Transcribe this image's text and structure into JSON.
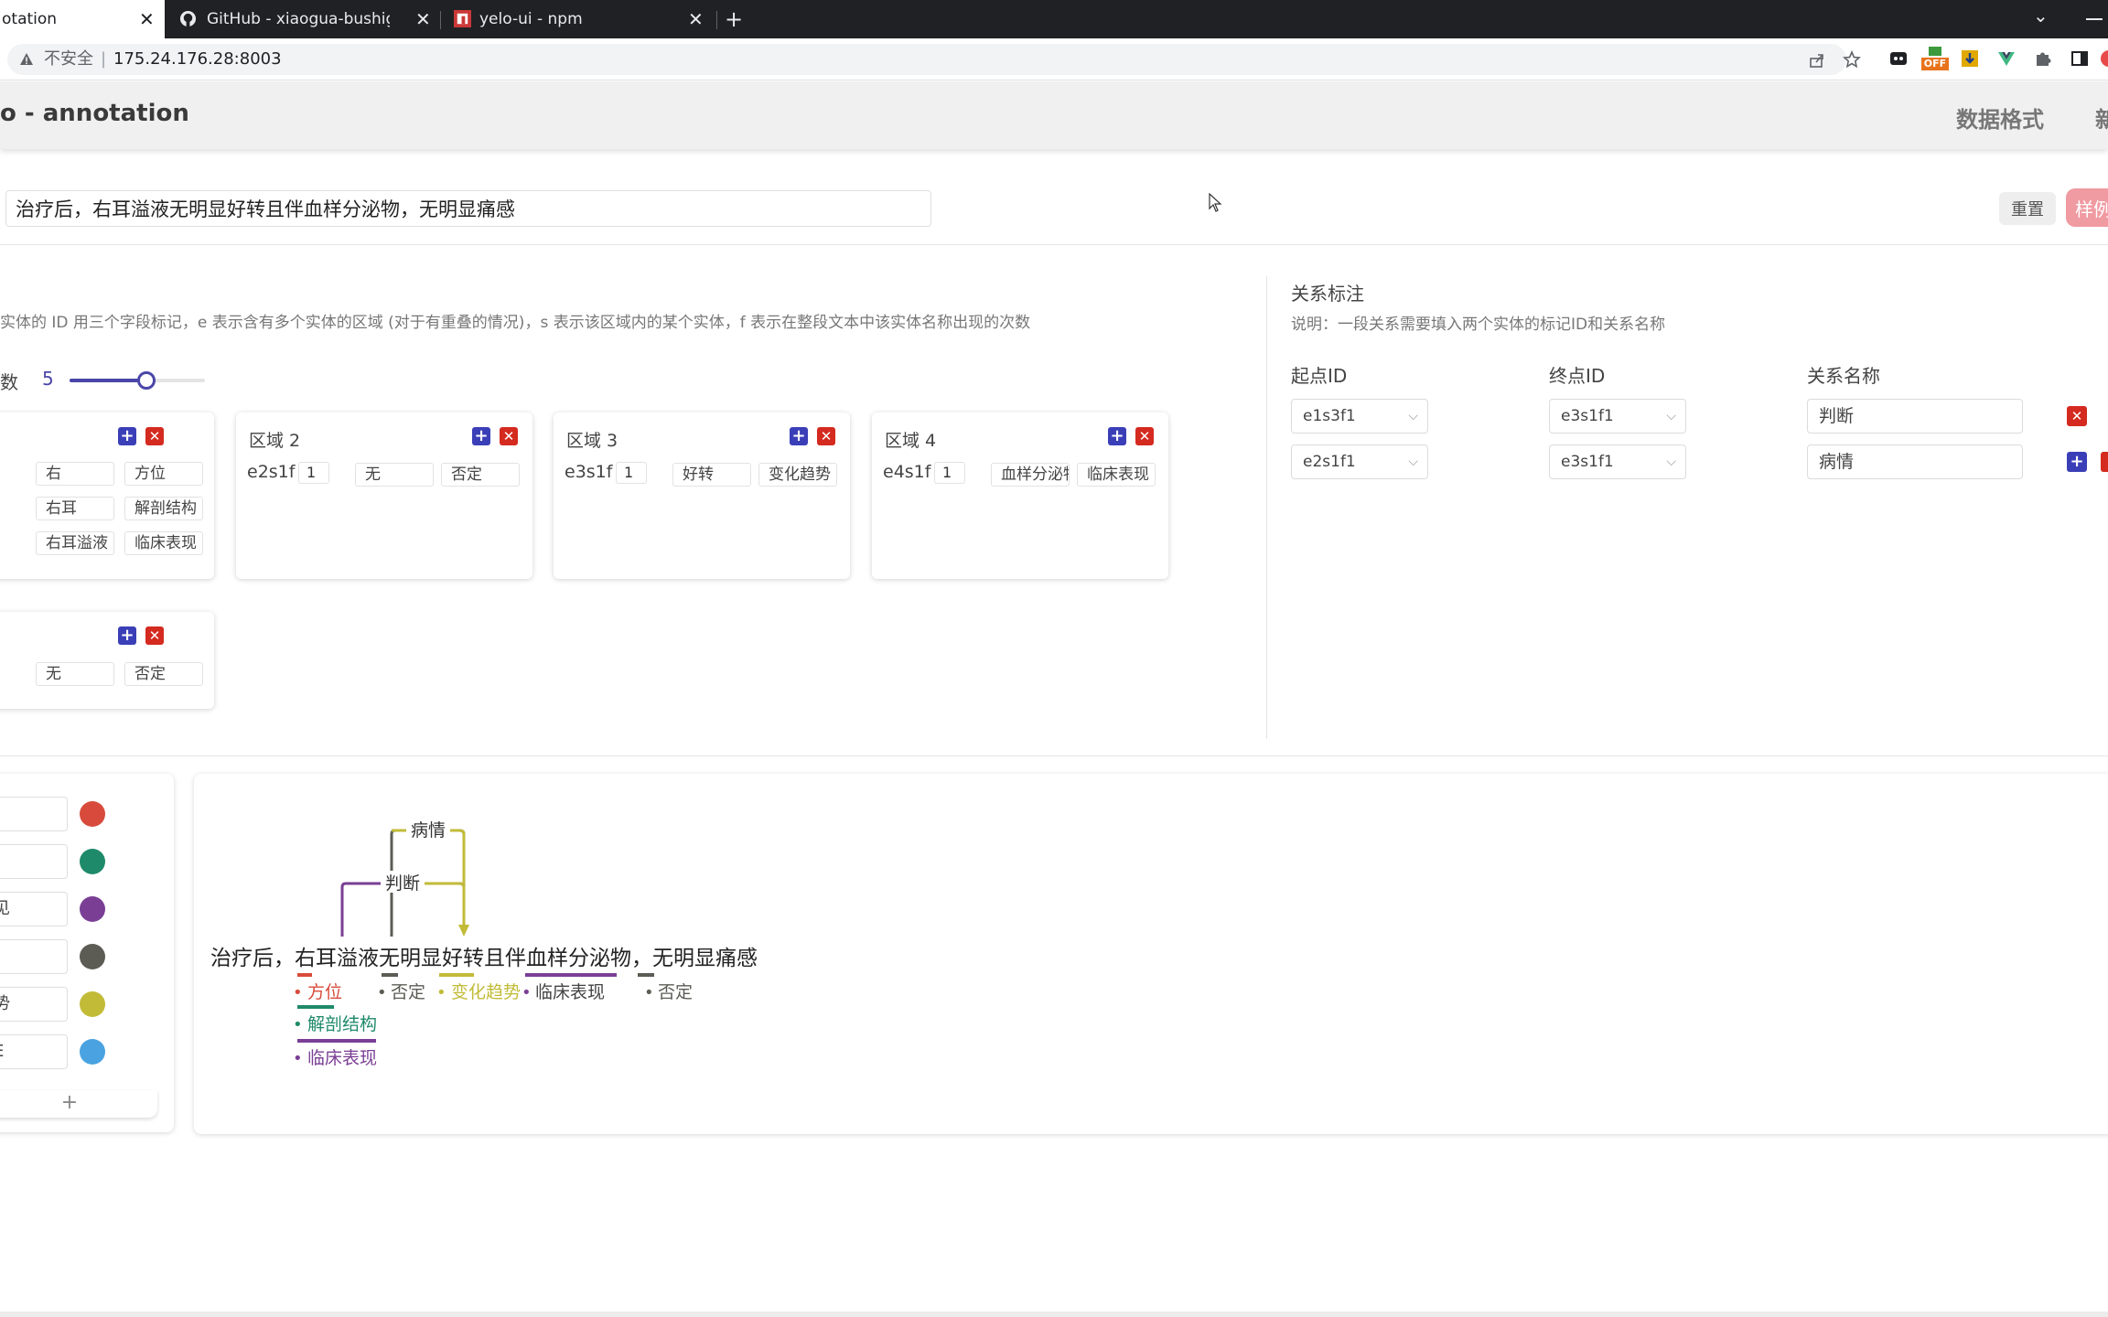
{
  "browser": {
    "tabs": [
      {
        "title": "otation",
        "close": "✕"
      },
      {
        "title": "GitHub - xiaogua-bushigua/ye",
        "close": "✕"
      },
      {
        "title": "yelo-ui - npm",
        "close": "✕"
      }
    ],
    "new_tab": "+",
    "tab_menu": "⌄",
    "insecure_label": "不安全",
    "url_sep": "|",
    "url": "175.24.176.28:8003",
    "ext_off_badge": "OFF"
  },
  "app": {
    "title": "o - annotation",
    "nav": [
      "数据格式",
      "新"
    ]
  },
  "input": {
    "text": "治疗后，右耳溢液无明显好转且伴血样分泌物，无明显痛感",
    "reset_label": "重置",
    "sample_label": "样例"
  },
  "entity_panel": {
    "description": "实体的 ID 用三个字段标记，e 表示含有多个实体的区域 (对于有重叠的情况)，s 表示该区域内的某个实体，f 表示在整段文本中该实体名称出现的次数",
    "count_label": "数",
    "count_value": "5",
    "slider_fraction": 0.57,
    "cards": [
      {
        "title": "",
        "rows": [
          {
            "id": "",
            "num": "",
            "text": "右",
            "label": "方位"
          },
          {
            "id": "",
            "num": "",
            "text": "右耳",
            "label": "解剖结构"
          },
          {
            "id": "",
            "num": "",
            "text": "右耳溢液",
            "label": "临床表现"
          }
        ]
      },
      {
        "title": "区域 2",
        "rows": [
          {
            "id": "e2s1f",
            "num": "1",
            "text": "无",
            "label": "否定"
          }
        ]
      },
      {
        "title": "区域 3",
        "rows": [
          {
            "id": "e3s1f",
            "num": "1",
            "text": "好转",
            "label": "变化趋势"
          }
        ]
      },
      {
        "title": "区域 4",
        "rows": [
          {
            "id": "e4s1f",
            "num": "1",
            "text": "血样分泌物",
            "label": "临床表现"
          }
        ]
      },
      {
        "title": "",
        "rows": [
          {
            "id": "",
            "num": "",
            "text": "无",
            "label": "否定"
          }
        ]
      }
    ]
  },
  "relation_panel": {
    "title": "关系标注",
    "description": "说明：一段关系需要填入两个实体的标记ID和关系名称",
    "col_start": "起点ID",
    "col_end": "终点ID",
    "col_name": "关系名称",
    "rows": [
      {
        "start": "e1s3f1",
        "end": "e3s1f1",
        "name": "判断"
      },
      {
        "start": "e2s1f1",
        "end": "e3s1f1",
        "name": "病情"
      }
    ],
    "chevron": "⌵"
  },
  "labels": {
    "items": [
      {
        "text": "",
        "color": "#d84b3c"
      },
      {
        "text": "]",
        "color": "#1f8a6a"
      },
      {
        "text": "见",
        "color": "#7a3f95"
      },
      {
        "text": "",
        "color": "#5c5c55"
      },
      {
        "text": "势",
        "color": "#c2bb38"
      },
      {
        "text": "E",
        "color": "#4aa3e0"
      }
    ],
    "add": "+"
  },
  "viz": {
    "sentence": "治疗后，右耳溢液无明显好转且伴血样分泌物，无明显痛感",
    "relations": [
      "病情",
      "判断"
    ],
    "tags": [
      {
        "text": "方位",
        "color": "#d84b3c"
      },
      {
        "text": "否定",
        "color": "#5c5c55"
      },
      {
        "text": "变化趋势",
        "color": "#c2bb38"
      },
      {
        "text": "临床表现",
        "color": "#7a3f95"
      },
      {
        "text": "否定",
        "color": "#5c5c55"
      },
      {
        "text": "解剖结构",
        "color": "#1f8a6a"
      },
      {
        "text": "临床表现",
        "color": "#7a3f95"
      }
    ],
    "bullet": "•"
  }
}
